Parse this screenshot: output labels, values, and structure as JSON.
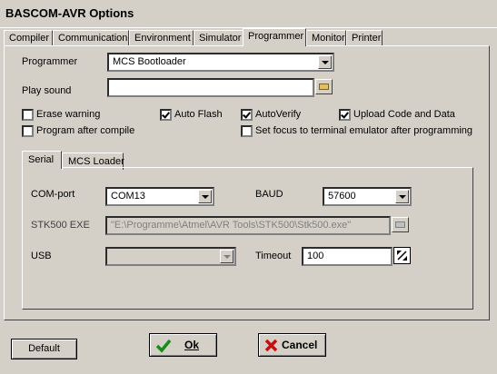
{
  "window": {
    "title": "BASCOM-AVR Options"
  },
  "tabs": [
    {
      "label": "Compiler"
    },
    {
      "label": "Communication"
    },
    {
      "label": "Environment"
    },
    {
      "label": "Simulator"
    },
    {
      "label": "Programmer"
    },
    {
      "label": "Monitor"
    },
    {
      "label": "Printer"
    }
  ],
  "active_tab": "Programmer",
  "programmer": {
    "programmer_label": "Programmer",
    "programmer_value": "MCS Bootloader",
    "play_sound_label": "Play sound",
    "play_sound_value": "",
    "checkboxes": [
      {
        "label": "Erase warning",
        "checked": false
      },
      {
        "label": "Auto Flash",
        "checked": true
      },
      {
        "label": "AutoVerify",
        "checked": true
      },
      {
        "label": "Upload Code and Data",
        "checked": true
      },
      {
        "label": "Program after compile",
        "checked": false
      },
      {
        "label": "Set focus to terminal emulator after programming",
        "checked": false
      }
    ]
  },
  "subtabs": [
    {
      "label": "Serial"
    },
    {
      "label": "MCS Loader"
    }
  ],
  "active_subtab": "Serial",
  "serial": {
    "com_port_label": "COM-port",
    "com_port_value": "COM13",
    "baud_label": "BAUD",
    "baud_value": "57600",
    "stk500_label": "STK500 EXE",
    "stk500_value": "\"E:\\Programme\\Atmel\\AVR Tools\\STK500\\Stk500.exe\"",
    "usb_label": "USB",
    "usb_value": "",
    "timeout_label": "Timeout",
    "timeout_value": "100"
  },
  "buttons": {
    "default": "Default",
    "ok": "Ok",
    "cancel": "Cancel"
  },
  "colors": {
    "ok_check": "#1a8a1a",
    "cancel_x": "#c01010"
  }
}
